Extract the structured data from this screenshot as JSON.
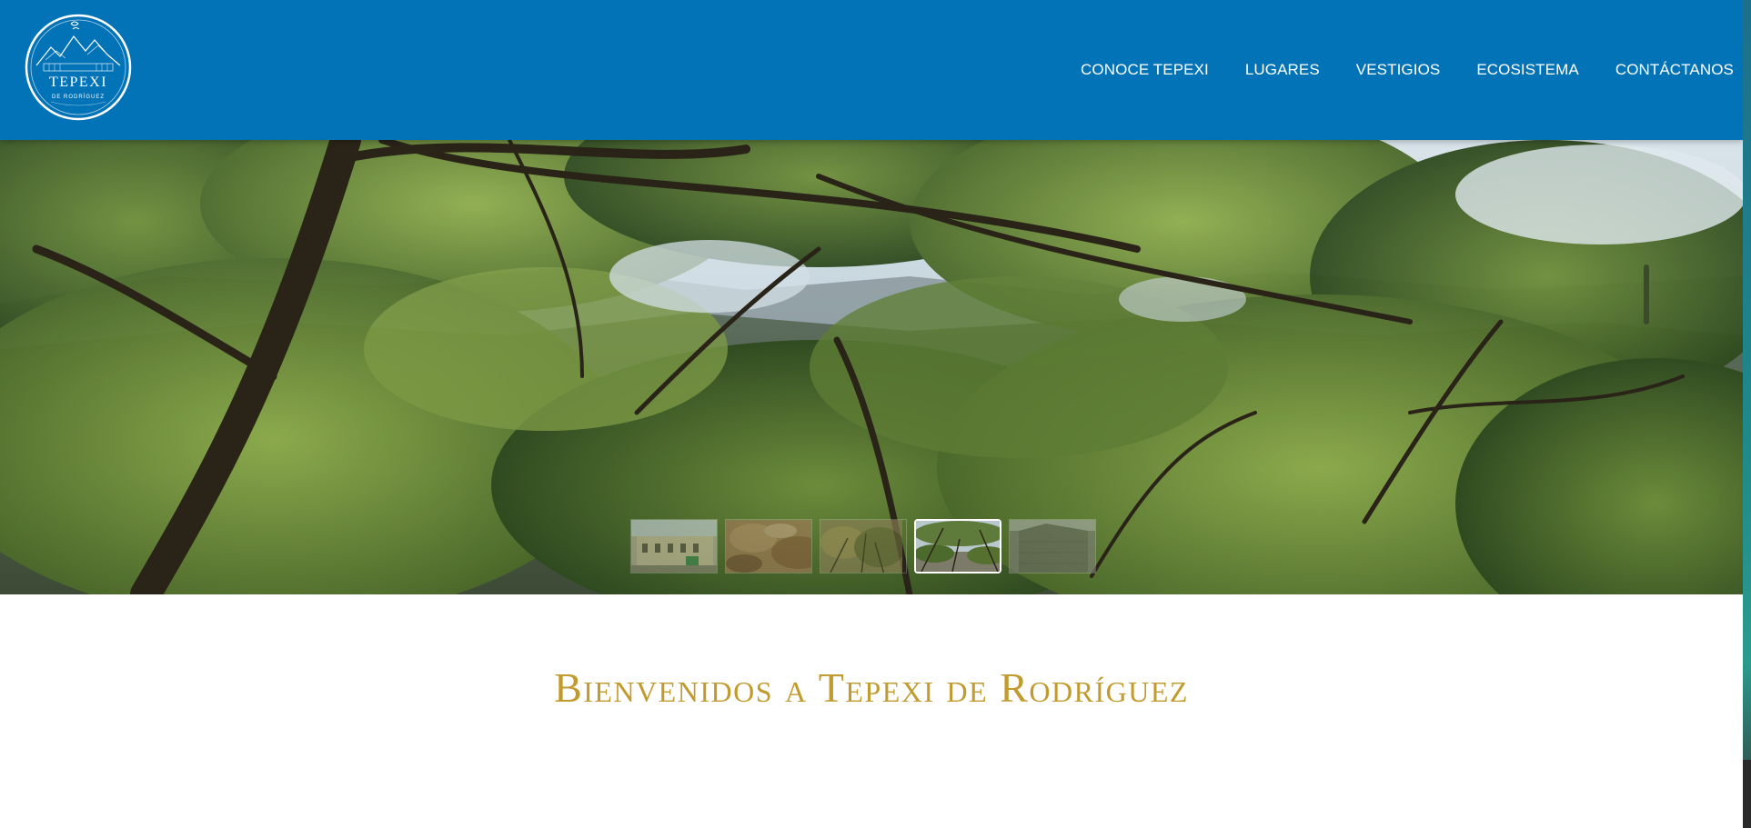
{
  "header": {
    "logo": {
      "title": "TEPEXI",
      "subtitle": "DE RODRÍGUEZ",
      "icon": "mountain-landscape-logo"
    },
    "nav": [
      {
        "label": "CONOCE TEPEXI"
      },
      {
        "label": "LUGARES"
      },
      {
        "label": "VESTIGIOS"
      },
      {
        "label": "ECOSISTEMA"
      },
      {
        "label": "CONTÁCTANOS"
      }
    ]
  },
  "hero": {
    "image": "forest-canopy-photo",
    "thumbnails": [
      {
        "image": "colonial-building-photo",
        "active": false
      },
      {
        "image": "rock-wall-photo",
        "active": false
      },
      {
        "image": "dry-shrubs-photo",
        "active": false
      },
      {
        "image": "forest-path-photo",
        "active": true
      },
      {
        "image": "stone-ruin-photo",
        "active": false
      }
    ]
  },
  "main": {
    "heading": "Bienvenidos a Tepexi de Rodríguez"
  },
  "colors": {
    "header_bg": "#0273b7",
    "heading": "#c29b2f",
    "nav_text": "#ffffff"
  }
}
